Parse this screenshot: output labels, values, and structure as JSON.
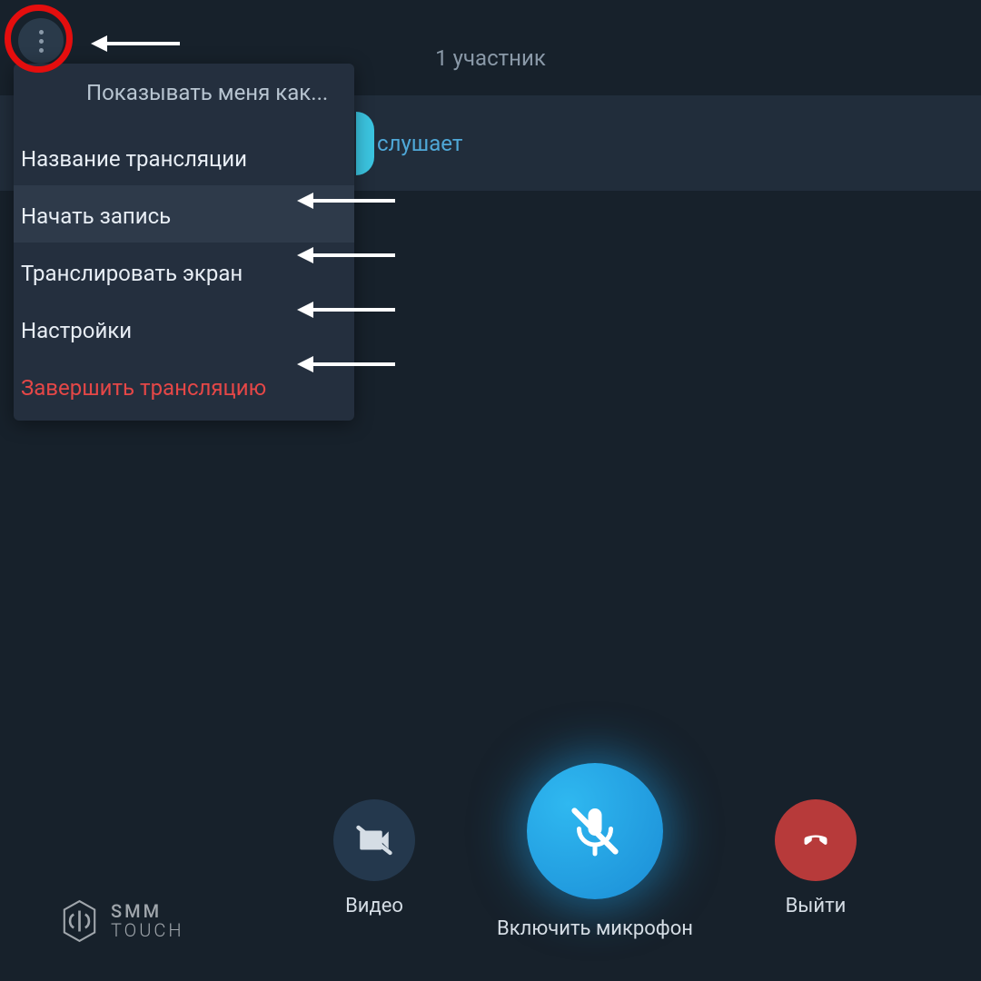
{
  "header": {
    "participants_count": "1 участник"
  },
  "participant": {
    "status": "слушает"
  },
  "menu": {
    "header": "Показывать меня как...",
    "items": [
      {
        "label": "Название трансляции"
      },
      {
        "label": "Начать запись"
      },
      {
        "label": "Транслировать экран"
      },
      {
        "label": "Настройки"
      },
      {
        "label": "Завершить трансляцию"
      }
    ]
  },
  "controls": {
    "video_label": "Видео",
    "mic_label": "Включить микрофон",
    "leave_label": "Выйти"
  },
  "watermark": {
    "line1": "SMM",
    "line2": "TOUCH"
  }
}
